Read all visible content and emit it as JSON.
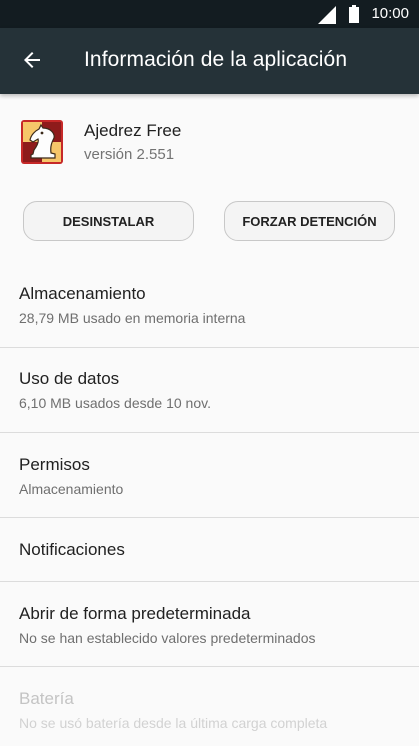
{
  "status_bar": {
    "time": "10:00",
    "icons": [
      "signal-icon",
      "battery-icon"
    ]
  },
  "app_bar": {
    "back_icon": "arrow-back-icon",
    "title": "Información de la aplicación"
  },
  "app": {
    "icon": "chess-knight-icon",
    "name": "Ajedrez Free",
    "version": "versión 2.551"
  },
  "buttons": {
    "uninstall": "DESINSTALAR",
    "force_stop": "FORZAR DETENCIÓN"
  },
  "settings": [
    {
      "title": "Almacenamiento",
      "subtitle": "28,79 MB usado en memoria interna",
      "enabled": true
    },
    {
      "title": "Uso de datos",
      "subtitle": "6,10 MB usados desde 10 nov.",
      "enabled": true
    },
    {
      "title": "Permisos",
      "subtitle": "Almacenamiento",
      "enabled": true
    },
    {
      "title": "Notificaciones",
      "subtitle": "",
      "enabled": true
    },
    {
      "title": "Abrir de forma predeterminada",
      "subtitle": "No se han establecido valores predeterminados",
      "enabled": true
    },
    {
      "title": "Batería",
      "subtitle": "No se usó batería desde la última carga completa",
      "enabled": false
    }
  ],
  "colors": {
    "status_bar": "#131c21",
    "app_bar": "#253238",
    "background": "#fafafa",
    "icon_red": "#c62828"
  }
}
